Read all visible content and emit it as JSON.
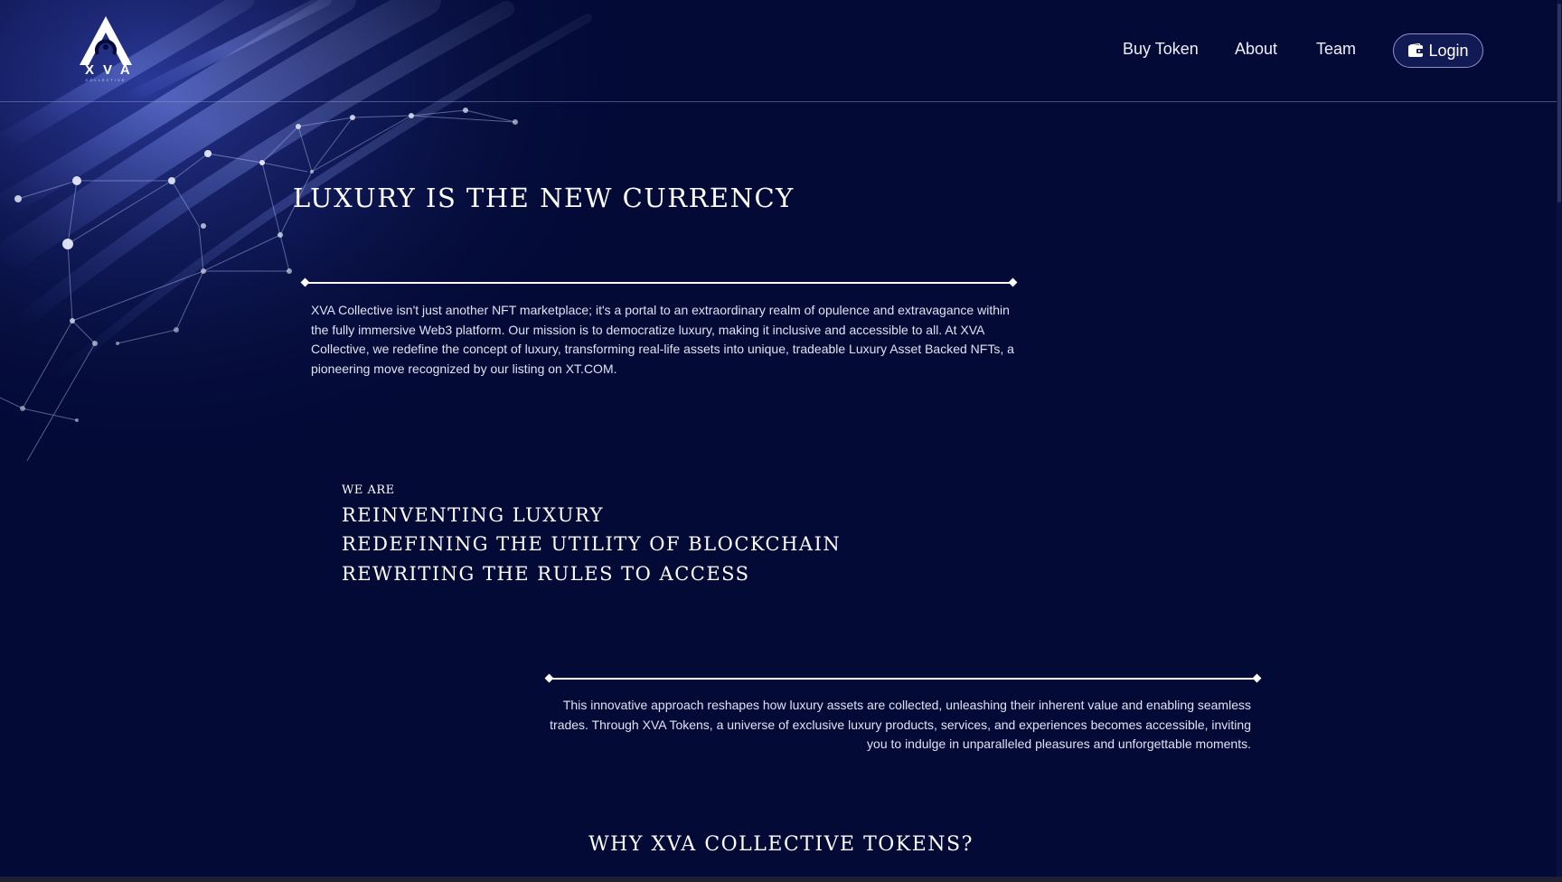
{
  "brand": {
    "logo_text": "XVA",
    "logo_subtext": "COLLECTIVE"
  },
  "nav": {
    "items": [
      {
        "label": "Buy Token"
      },
      {
        "label": "About"
      },
      {
        "label": "Team"
      }
    ],
    "login_label": "Login",
    "login_icon": "wallet-icon"
  },
  "hero": {
    "title": "LUXURY IS THE NEW CURRENCY",
    "intro": "XVA Collective isn't just another NFT marketplace; it's a portal to an extraordinary realm of opulence and extravagance within the fully immersive Web3 platform. Our mission is to democratize luxury, making it inclusive and accessible to all. At XVA Collective, we redefine the concept of luxury, transforming real-life assets into unique, tradeable Luxury Asset Backed NFTs, a pioneering move recognized by our listing on XT.COM."
  },
  "we_are": {
    "label": "WE ARE",
    "statements": [
      "REINVENTING LUXURY",
      "REDEFINING THE UTILITY OF BLOCKCHAIN",
      "REWRITING THE RULES TO ACCESS"
    ]
  },
  "approach": {
    "text": "This innovative approach reshapes how luxury assets are collected, unleashing their inherent value and enabling seamless trades. Through XVA Tokens, a universe of exclusive luxury products, services, and experiences becomes accessible, inviting you to indulge in unparalleled pleasures and unforgettable moments."
  },
  "why": {
    "title": "WHY XVA COLLECTIVE TOKENS?"
  },
  "colors": {
    "background": "#030a36",
    "accent": "#3b4fd8",
    "text": "#ffffff"
  }
}
